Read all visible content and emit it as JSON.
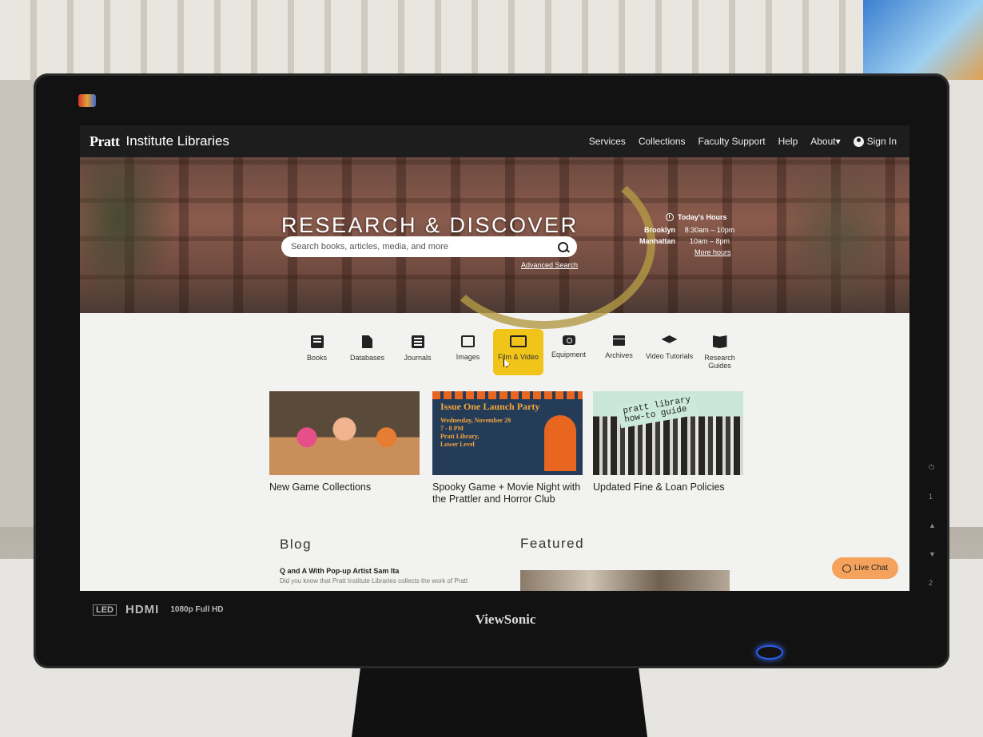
{
  "navbar": {
    "logo": "Pratt",
    "site_name": "Institute Libraries",
    "links": [
      "Services",
      "Collections",
      "Faculty Support",
      "Help",
      "About"
    ],
    "about_caret": "▾",
    "sign_in": "Sign In"
  },
  "hero": {
    "title": "RESEARCH & DISCOVER",
    "search_placeholder": "Search books, articles, media, and more",
    "advanced_search": "Advanced Search",
    "hours": {
      "title": "Today's Hours",
      "rows": [
        {
          "location": "Brooklyn",
          "time": "8:30am – 10pm"
        },
        {
          "location": "Manhattan",
          "time": "10am – 8pm"
        }
      ],
      "more": "More hours"
    }
  },
  "quick_links": [
    {
      "label": "Books",
      "icon": "book-icon"
    },
    {
      "label": "Databases",
      "icon": "document-icon"
    },
    {
      "label": "Journals",
      "icon": "list-icon"
    },
    {
      "label": "Images",
      "icon": "images-icon"
    },
    {
      "label": "Film & Video",
      "icon": "monitor-icon",
      "active": true
    },
    {
      "label": "Equipment",
      "icon": "camera-icon"
    },
    {
      "label": "Archives",
      "icon": "archive-box-icon"
    },
    {
      "label": "Video Tutorials",
      "icon": "graduation-cap-icon"
    },
    {
      "label": "Research Guides",
      "icon": "open-book-icon"
    }
  ],
  "cards": [
    {
      "title": "New Game Collections"
    },
    {
      "title": "Spooky Game + Movie Night with the Prattler and Horror Club",
      "image_title": "Issue One Launch Party",
      "image_details": [
        "Wednesday, November 29",
        "7 - 8 PM",
        "Pratt Library,",
        "Lower Level"
      ]
    },
    {
      "title": "Updated Fine & Loan Policies",
      "image_label": [
        "pratt library",
        "how-to guide"
      ]
    }
  ],
  "blog": {
    "heading": "Blog",
    "post_title": "Q and A With Pop-up Artist Sam Ita",
    "post_snippet": "Did you know that Pratt Institute Libraries collects the work of Pratt"
  },
  "featured": {
    "heading": "Featured"
  },
  "live_chat": "Live Chat",
  "monitor": {
    "brand": "ViewSonic",
    "badges": [
      "LED",
      "HDMI",
      "1080p Full HD"
    ],
    "side_buttons": [
      "⏻",
      "1",
      "▲",
      "▼",
      "2"
    ]
  },
  "colors": {
    "navbar": "#1d1d1d",
    "active_tile": "#f0c419",
    "live_chat": "#f5a35c"
  }
}
